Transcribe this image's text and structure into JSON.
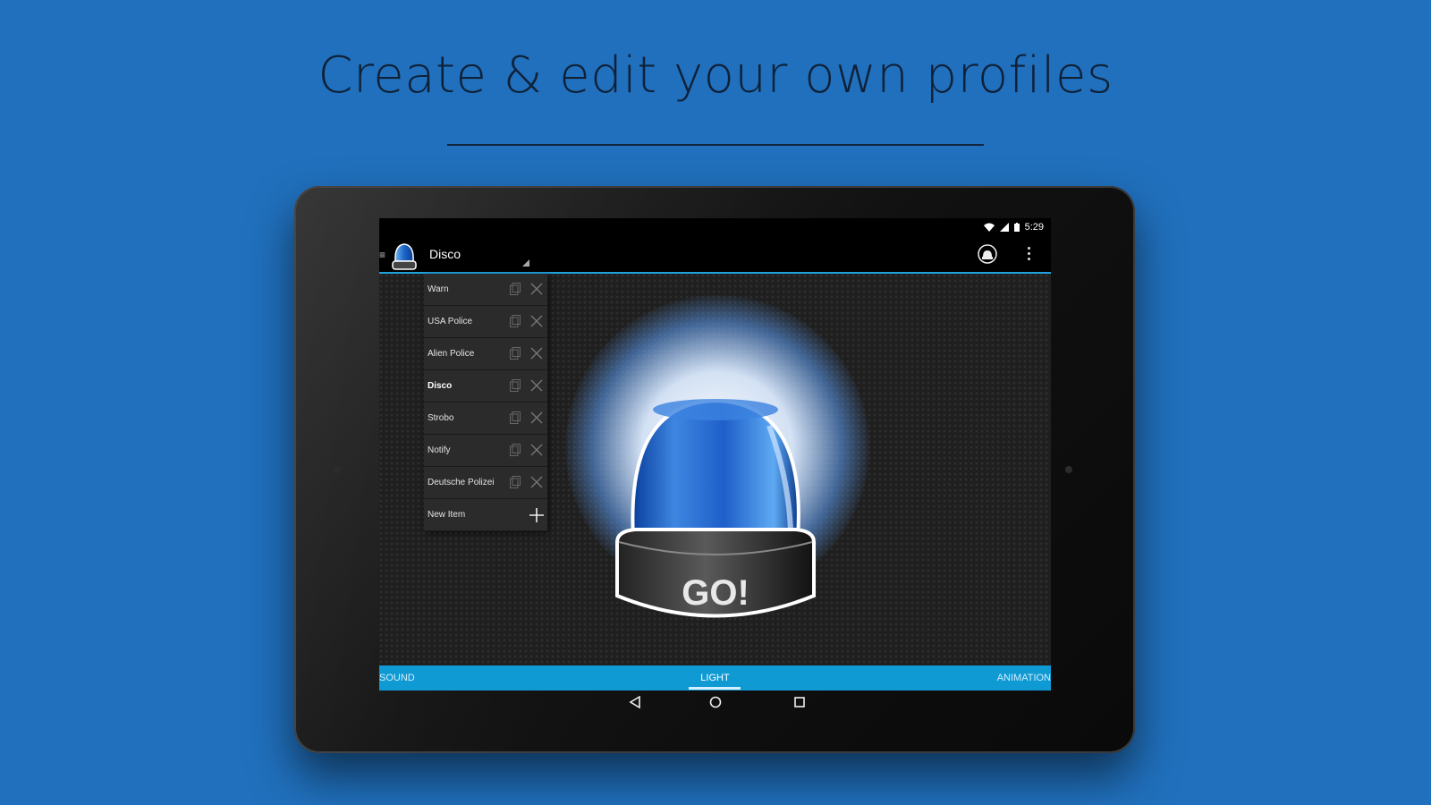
{
  "headline": "Create & edit your own profiles",
  "status_bar": {
    "time": "5:29"
  },
  "app_bar": {
    "title": "Disco"
  },
  "profiles": [
    {
      "label": "Warn",
      "active": false
    },
    {
      "label": "USA Police",
      "active": false
    },
    {
      "label": "Alien Police",
      "active": false
    },
    {
      "label": "Disco",
      "active": true
    },
    {
      "label": "Strobo",
      "active": false
    },
    {
      "label": "Notify",
      "active": false
    },
    {
      "label": "Deutsche Polizei",
      "active": false
    }
  ],
  "new_item_label": "New Item",
  "go_label": "GO!",
  "tabs": {
    "sound": "SOUND",
    "light": "LIGHT",
    "animation": "ANIMATION",
    "selected": "LIGHT"
  },
  "colors": {
    "background": "#2070bd",
    "accent": "#1fa3e0",
    "tab_bar": "#0f9ad4"
  },
  "icons": {
    "status": [
      "wifi-icon",
      "signal-icon",
      "battery-icon"
    ],
    "app_bar": [
      "menu-icon",
      "beacon-logo-icon",
      "overlay-toggle-icon",
      "more-vert-icon"
    ],
    "profile_row": [
      "copy-icon",
      "delete-icon"
    ],
    "new_item": "add-icon",
    "navigation": [
      "back-icon",
      "home-icon",
      "recents-icon"
    ]
  }
}
